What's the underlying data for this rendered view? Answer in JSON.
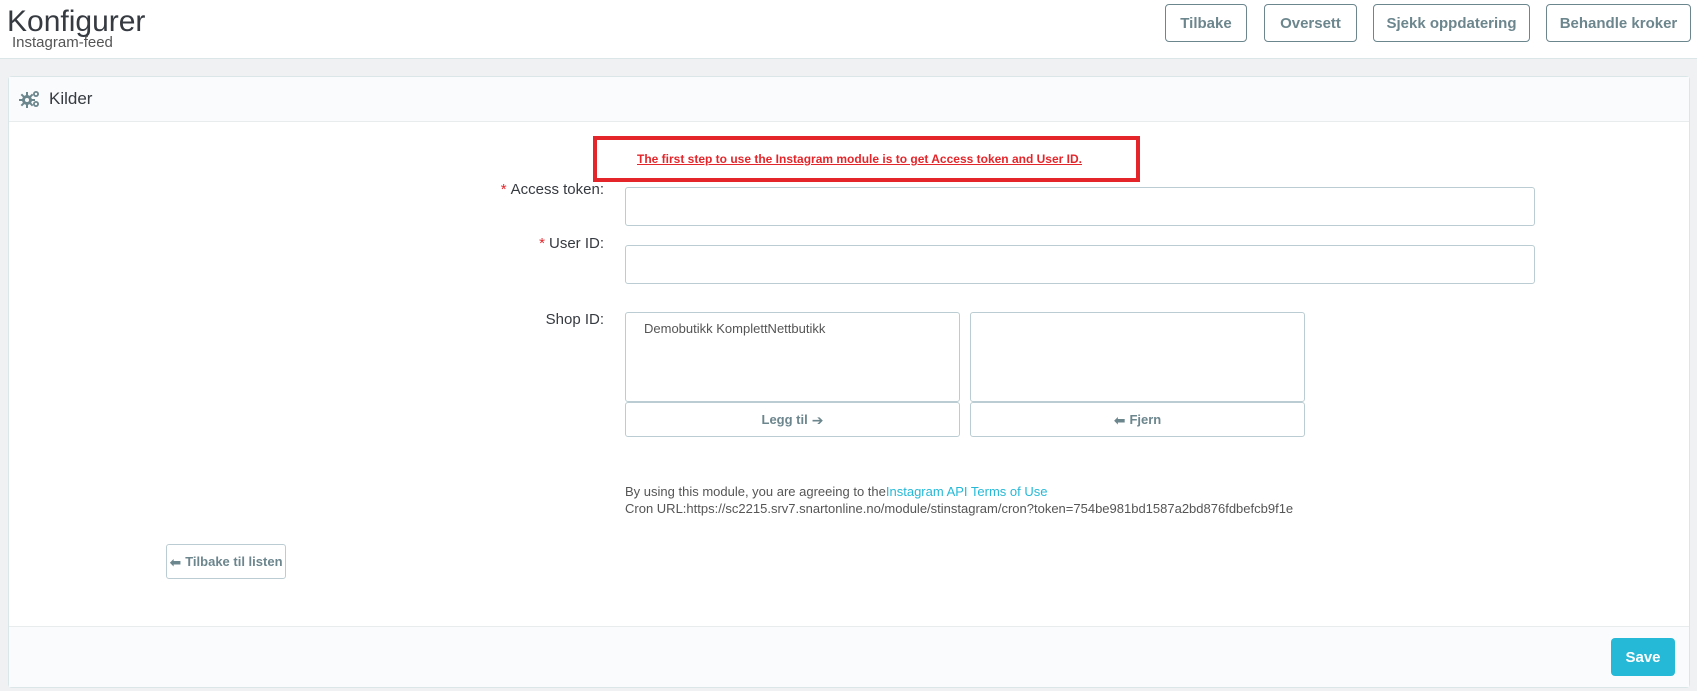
{
  "header": {
    "title": "Konfigurer",
    "subtitle": "Instagram-feed",
    "buttons": {
      "back": "Tilbake",
      "translate": "Oversett",
      "check_update": "Sjekk oppdatering",
      "manage_hooks": "Behandle kroker"
    }
  },
  "panel": {
    "heading": "Kilder",
    "heading_icon": "cogs-icon",
    "notice": "The first step to use the Instagram module is to get Access token and User ID.",
    "fields": {
      "access_token": {
        "required": "*",
        "label": "Access token:",
        "value": ""
      },
      "user_id": {
        "required": "*",
        "label": "User ID:",
        "value": ""
      },
      "shop_id": {
        "label": "Shop ID:",
        "available": [
          "Demobutikk KomplettNettbutikk"
        ],
        "selected": [],
        "add_label": "Legg til",
        "remove_label": "Fjern"
      }
    },
    "terms_prefix": "By using this module, you are agreeing to the",
    "terms_link": "Instagram API Terms of Use",
    "cron_url": "Cron URL:https://sc2215.srv7.snartonline.no/module/stinstagram/cron?token=754be981bd1587a2bd876fdbefcb9f1e",
    "back_to_list": "Tilbake til listen",
    "save": "Save"
  },
  "colors": {
    "accent": "#25b9d7",
    "alert": "#e4262b",
    "button_text": "#6c868e"
  }
}
